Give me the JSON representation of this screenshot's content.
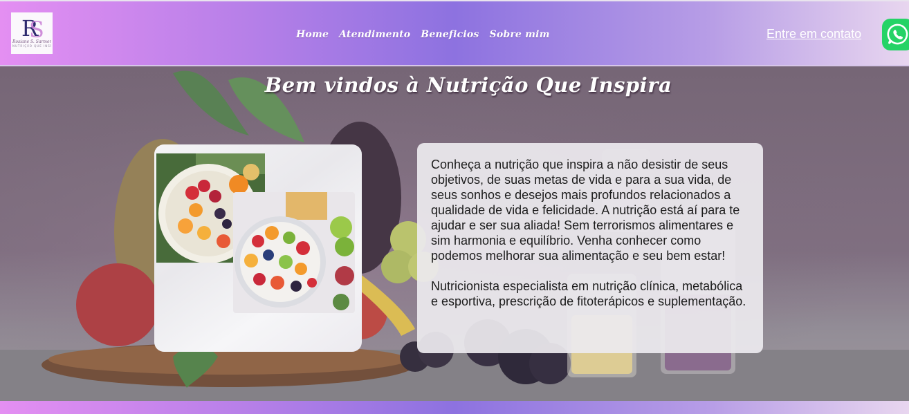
{
  "header": {
    "logo": {
      "monogram": "RS",
      "tagline": "Rosiane S. Sarmento",
      "subtitle": "NUTRIÇÃO QUE INSPIRA"
    },
    "nav": [
      "Home",
      "Atendimento",
      "Beneficios",
      "Sobre mim"
    ],
    "contact_label": "Entre em contato",
    "whatsapp_icon": "whatsapp-icon"
  },
  "hero": {
    "title": "Bem vindos à Nutrição Que Inspira",
    "paragraphs": [
      "Conheça a nutrição que inspira a não desistir de seus objetivos, de suas metas de vida e para a sua vida, de seus sonhos e desejos mais profundos relacionados a qualidade de vida e felicidade. A nutrição está aí para te ajudar e ser sua aliada! Sem terrorismos alimentares e sim harmonia e equilíbrio. Venha conhecer como podemos melhorar sua alimentação e seu bem estar!",
      "Nutricionista especialista em nutrição clínica, metabólica e esportiva, prescrição de fitoterápicos e suplementação."
    ]
  },
  "colors": {
    "gradient_start": "#e48ff2",
    "gradient_mid": "#8d72e0",
    "gradient_end": "#e8d6ef",
    "whatsapp": "#25d366"
  }
}
